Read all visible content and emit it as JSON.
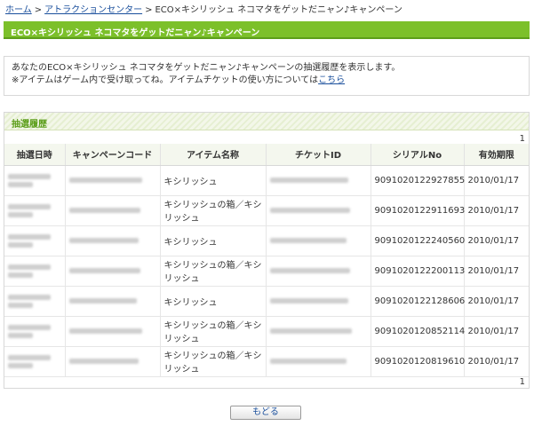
{
  "breadcrumb": {
    "home": "ホーム",
    "attraction_center": "アトラクションセンター",
    "current": "ECO×キシリッシュ ネコマタをゲットだニャン♪キャンペーン",
    "separator": ">"
  },
  "page_title": "ECO×キシリッシュ ネコマタをゲットだニャン♪キャンペーン",
  "info": {
    "line1": "あなたのECO×キシリッシュ ネコマタをゲットだニャン♪キャンペーンの抽選履歴を表示します。",
    "line2_prefix": "※アイテムはゲーム内で受け取ってね。アイテムチケットの使い方については",
    "link_text": "こちら"
  },
  "section_title": "抽選履歴",
  "pager": {
    "top": "1",
    "bottom": "1"
  },
  "table": {
    "headers": [
      "抽選日時",
      "キャンペーンコード",
      "アイテム名称",
      "チケットID",
      "シリアルNo",
      "有効期限"
    ],
    "rows": [
      {
        "item": "キシリッシュ",
        "serial": "9091020122927855",
        "expiry": "2010/01/17"
      },
      {
        "item": "キシリッシュの箱／キシリッシュ",
        "serial": "9091020122911693",
        "expiry": "2010/01/17"
      },
      {
        "item": "キシリッシュ",
        "serial": "9091020122240560",
        "expiry": "2010/01/17"
      },
      {
        "item": "キシリッシュの箱／キシリッシュ",
        "serial": "9091020122200113",
        "expiry": "2010/01/17"
      },
      {
        "item": "キシリッシュ",
        "serial": "9091020122128606",
        "expiry": "2010/01/17"
      },
      {
        "item": "キシリッシュの箱／キシリッシュ",
        "serial": "9091020120852114",
        "expiry": "2010/01/17"
      },
      {
        "item": "キシリッシュの箱／キシリッシュ",
        "serial": "9091020120819610",
        "expiry": "2010/01/17"
      }
    ]
  },
  "back_button": "もどる",
  "colors": {
    "accent": "#7cc02a",
    "link": "#1a4f9c",
    "header_bg": "#f4f7ee"
  }
}
